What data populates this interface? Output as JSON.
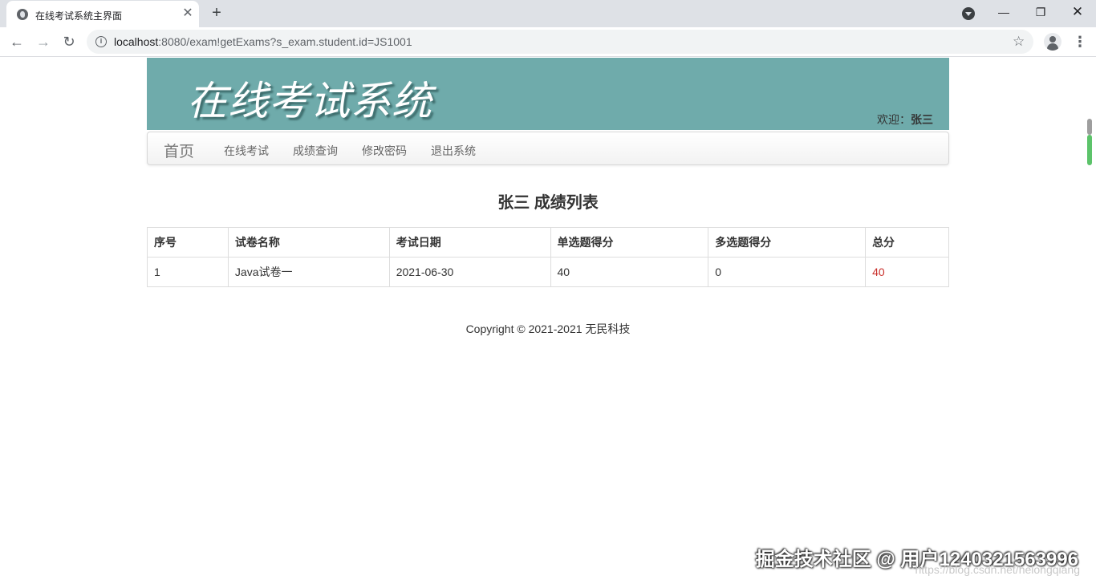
{
  "browser": {
    "tab_title": "在线考试系统主界面",
    "tab_close": "✕",
    "new_tab": "+",
    "url_host": "localhost",
    "url_rest": ":8080/exam!getExams?s_exam.student.id=JS1001",
    "icons": [
      "globe-icon",
      "close-icon",
      "plus-icon",
      "chevron-down-icon",
      "minimize-icon",
      "maximize-icon",
      "close-window-icon",
      "back-icon",
      "forward-icon",
      "reload-icon",
      "info-icon",
      "star-icon",
      "avatar-icon",
      "more-icon"
    ]
  },
  "header": {
    "title": "在线考试系统",
    "welcome_prefix": "欢迎：",
    "user_name": "张三"
  },
  "nav": {
    "brand": "首页",
    "links": [
      "在线考试",
      "成绩查询",
      "修改密码",
      "退出系统"
    ]
  },
  "main": {
    "heading": "张三 成绩列表",
    "table": {
      "headers": [
        "序号",
        "试卷名称",
        "考试日期",
        "单选题得分",
        "多选题得分",
        "总分"
      ],
      "rows": [
        [
          "1",
          "Java试卷一",
          "2021-06-30",
          "40",
          "0",
          "40"
        ]
      ]
    }
  },
  "footer": {
    "copyright": "Copyright © 2021-2021 无民科技"
  },
  "watermark": {
    "text": "掘金技术社区 @ 用户1240321563996",
    "sub": "https://blog.csdn.net/heiongqiang"
  },
  "colors": {
    "banner": "#6fabab",
    "total_score": "#c9302c"
  }
}
